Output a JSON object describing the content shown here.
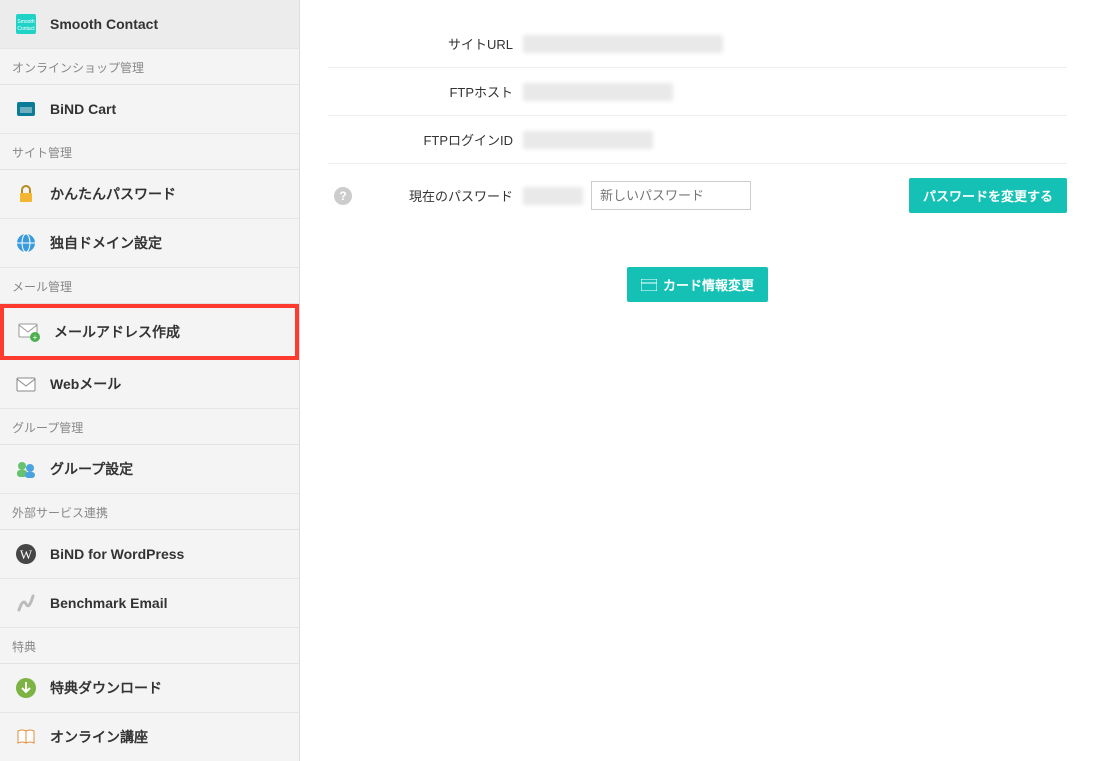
{
  "sidebar": {
    "top_items": [
      {
        "label": "Smooth Contact",
        "icon": "smooth-contact-icon"
      }
    ],
    "sections": [
      {
        "header": "オンラインショップ管理",
        "items": [
          {
            "label": "BiND Cart",
            "icon": "cart-icon"
          }
        ]
      },
      {
        "header": "サイト管理",
        "items": [
          {
            "label": "かんたんパスワード",
            "icon": "lock-icon"
          },
          {
            "label": "独自ドメイン設定",
            "icon": "globe-icon"
          }
        ]
      },
      {
        "header": "メール管理",
        "items": [
          {
            "label": "メールアドレス作成",
            "icon": "mail-create-icon",
            "highlight": true
          },
          {
            "label": "Webメール",
            "icon": "webmail-icon"
          }
        ]
      },
      {
        "header": "グループ管理",
        "items": [
          {
            "label": "グループ設定",
            "icon": "group-icon"
          }
        ]
      },
      {
        "header": "外部サービス連携",
        "items": [
          {
            "label": "BiND for WordPress",
            "icon": "wordpress-icon"
          },
          {
            "label": "Benchmark Email",
            "icon": "benchmark-icon"
          }
        ]
      },
      {
        "header": "特典",
        "items": [
          {
            "label": "特典ダウンロード",
            "icon": "download-icon"
          },
          {
            "label": "オンライン講座",
            "icon": "book-icon"
          }
        ]
      }
    ]
  },
  "form": {
    "site_url_label": "サイトURL",
    "ftp_host_label": "FTPホスト",
    "ftp_login_label": "FTPログインID",
    "current_password_label": "現在のパスワード",
    "new_password_placeholder": "新しいパスワード",
    "change_password_button": "パスワードを変更する",
    "card_button": "カード情報変更"
  },
  "colors": {
    "accent": "#14c1b4",
    "highlight": "#ff3b30"
  }
}
